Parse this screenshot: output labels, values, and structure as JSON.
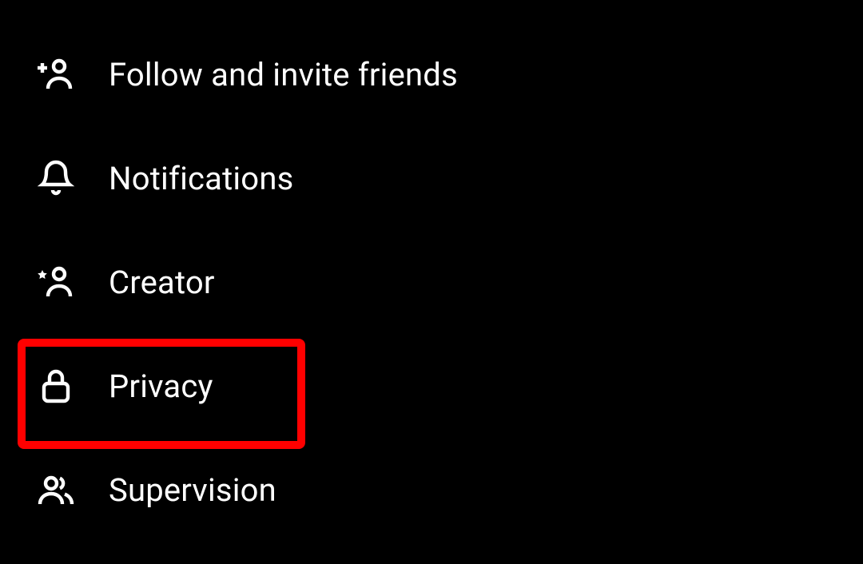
{
  "menu": {
    "items": [
      {
        "label": "Follow and invite friends",
        "icon": "add-person-icon",
        "highlighted": false
      },
      {
        "label": "Notifications",
        "icon": "bell-icon",
        "highlighted": false
      },
      {
        "label": "Creator",
        "icon": "star-person-icon",
        "highlighted": false
      },
      {
        "label": "Privacy",
        "icon": "lock-icon",
        "highlighted": true
      },
      {
        "label": "Supervision",
        "icon": "people-icon",
        "highlighted": false
      }
    ]
  }
}
